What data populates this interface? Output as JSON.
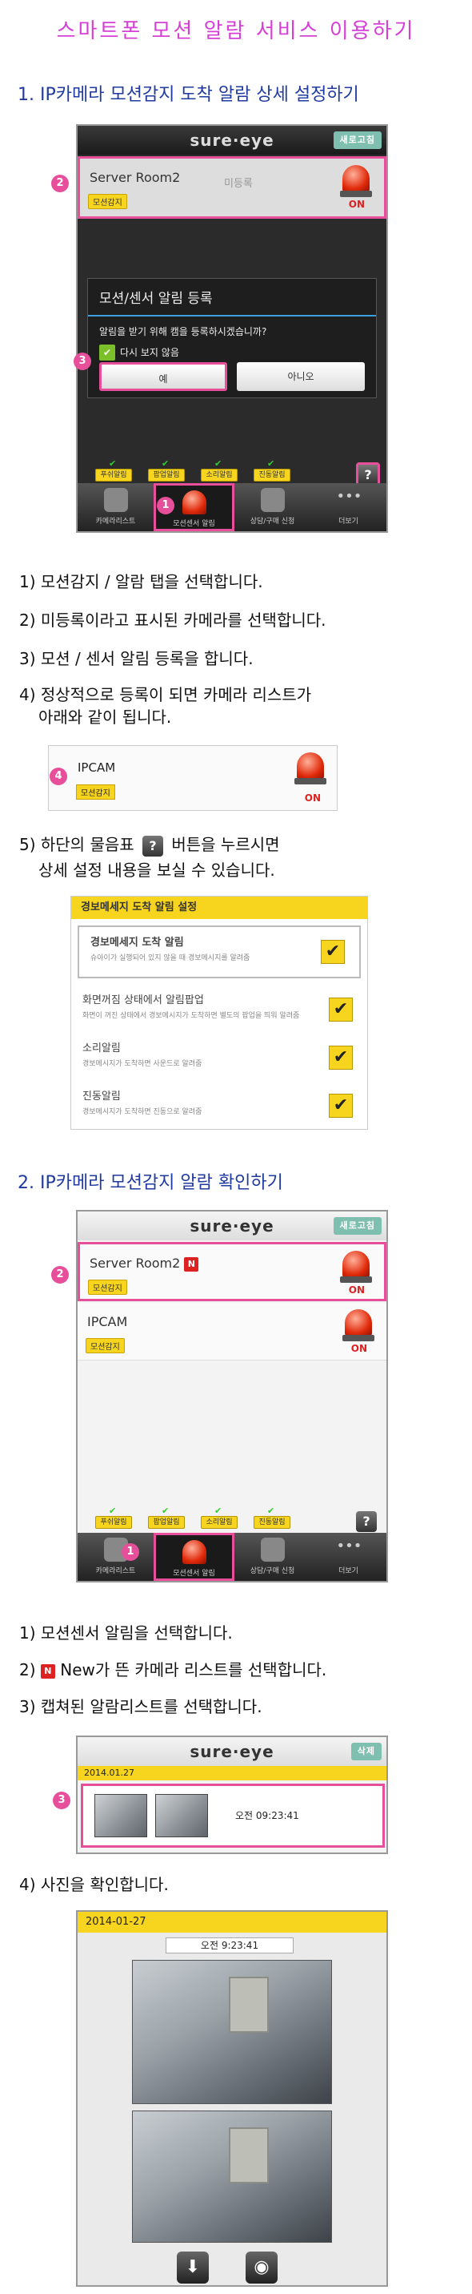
{
  "title": "스마트폰 모션 알람 서비스 이용하기",
  "section1": {
    "heading": "1. IP카메라 모션감지 도착 알람 상세 설정하기",
    "phone": {
      "app_name": "sure·eye",
      "top_button": "새로고침",
      "camera": {
        "name": "Server Room2",
        "sub": "미등록",
        "tag": "모션감지",
        "status": "ON"
      },
      "dialog": {
        "title": "모션/센서 알림 등록",
        "message": "알림을 받기 위해 캠을 등록하시겠습니까?",
        "checkbox": "다시 보지 않음",
        "yes": "예",
        "no": "아니오"
      },
      "toggles": [
        "푸쉬알림",
        "팝업알림",
        "소리알림",
        "진동알림"
      ],
      "tabs": [
        "카메라리스트",
        "모션센서 알림",
        "상담/구매 신청",
        "더보기"
      ]
    },
    "badges": [
      "1",
      "2",
      "3"
    ],
    "steps": [
      "1) 모션감지 / 알람 탭을 선택합니다.",
      "2) 미등록이라고 표시된 카메라를 선택합니다.",
      "3) 모션 / 센서 알림 등록을 합니다.",
      "4) 정상적으로 등록이 되면 카메라 리스트가",
      "아래와 같이 됩니다."
    ],
    "result_row": {
      "badge": "4",
      "name": "IPCAM",
      "tag": "모션감지",
      "status": "ON"
    },
    "step5": [
      "5) 하단의 물음표",
      "버튼을 누르시면",
      "상세 설정 내용을 보실 수 있습니다."
    ],
    "settings": {
      "header": "경보메세지 도착 알림 설정",
      "rows": [
        {
          "title": "경보메세지 도착 알림",
          "desc": "슈아이가 실행되어 있지 않을 때 경보메시지를 알려줌"
        },
        {
          "title": "화면꺼짐 상태에서 알림팝업",
          "desc": "화면이 꺼진 상태에서 경보메시지가 도착하면 별도의 팝업을 띄워 알려줌"
        },
        {
          "title": "소리알림",
          "desc": "경보메시지가 도착하면 사운드로 알려줌"
        },
        {
          "title": "진동알림",
          "desc": "경보메시지가 도착하면 진동으로 알려줌"
        }
      ]
    }
  },
  "section2": {
    "heading": "2. IP카메라 모션감지 알람 확인하기",
    "phone": {
      "app_name": "sure·eye",
      "top_button": "새로고침",
      "cameras": [
        {
          "name": "Server Room2",
          "new": "N",
          "tag": "모션감지",
          "status": "ON"
        },
        {
          "name": "IPCAM",
          "tag": "모션감지",
          "status": "ON"
        }
      ],
      "toggles": [
        "푸쉬알림",
        "팝업알림",
        "소리알림",
        "진동알림"
      ],
      "tabs": [
        "카메라리스트",
        "모션센서 알림",
        "상담/구매 신청",
        "더보기"
      ]
    },
    "badges": [
      "1",
      "2",
      "3"
    ],
    "steps": [
      "1) 모션센서 알림을 선택합니다.",
      "New가 뜬 카메라 리스트를 선택합니다.",
      "3) 캡쳐된 알람리스트를 선택합니다."
    ],
    "step2_prefix": "2)",
    "alarm_list": {
      "app_name": "sure·eye",
      "button": "삭제",
      "date": "2014.01.27",
      "time": "오전 09:23:41"
    },
    "step4": "4) 사진을 확인합니다.",
    "photo_view": {
      "date": "2014-01-27",
      "time": "오전 9:23:41"
    }
  }
}
